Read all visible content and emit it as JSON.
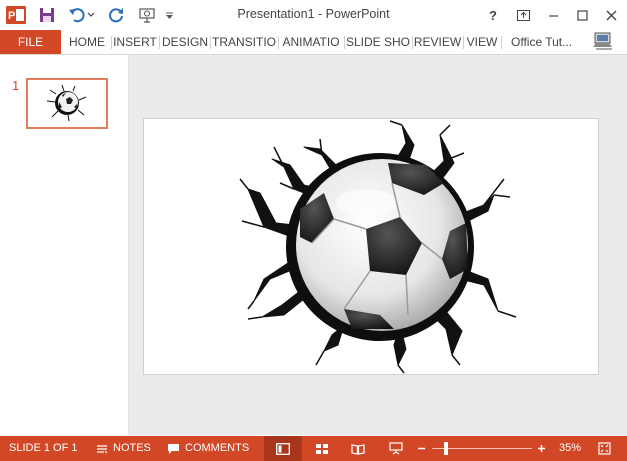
{
  "window": {
    "title": "Presentation1 - PowerPoint",
    "controls": [
      "?",
      "restore-ribbon",
      "minimize",
      "maximize",
      "close"
    ]
  },
  "qat": {
    "icons": [
      "powerpoint-logo",
      "save-icon",
      "undo-icon",
      "redo-icon",
      "start-from-beginning-icon",
      "customize-qat-icon"
    ]
  },
  "ribbon": {
    "tabs": [
      {
        "label": "FILE"
      },
      {
        "label": "HOME"
      },
      {
        "label": "INSERT"
      },
      {
        "label": "DESIGN"
      },
      {
        "label": "TRANSITIO"
      },
      {
        "label": "ANIMATIO"
      },
      {
        "label": "SLIDE SHO"
      },
      {
        "label": "REVIEW"
      },
      {
        "label": "VIEW"
      }
    ],
    "account": "Office Tut..."
  },
  "thumbnails": [
    {
      "number": "1",
      "selected": true
    }
  ],
  "slide": {
    "image": "soccer-ball-breaking-through-wall"
  },
  "status": {
    "slide_info": "SLIDE 1 OF 1",
    "notes": "NOTES",
    "comments": "COMMENTS",
    "zoom": "35%",
    "zoom_value": 35
  },
  "colors": {
    "accent": "#d24726",
    "active_view": "#a8361b",
    "canvas": "#ebebeb",
    "thumb_border": "#e07b5c"
  }
}
